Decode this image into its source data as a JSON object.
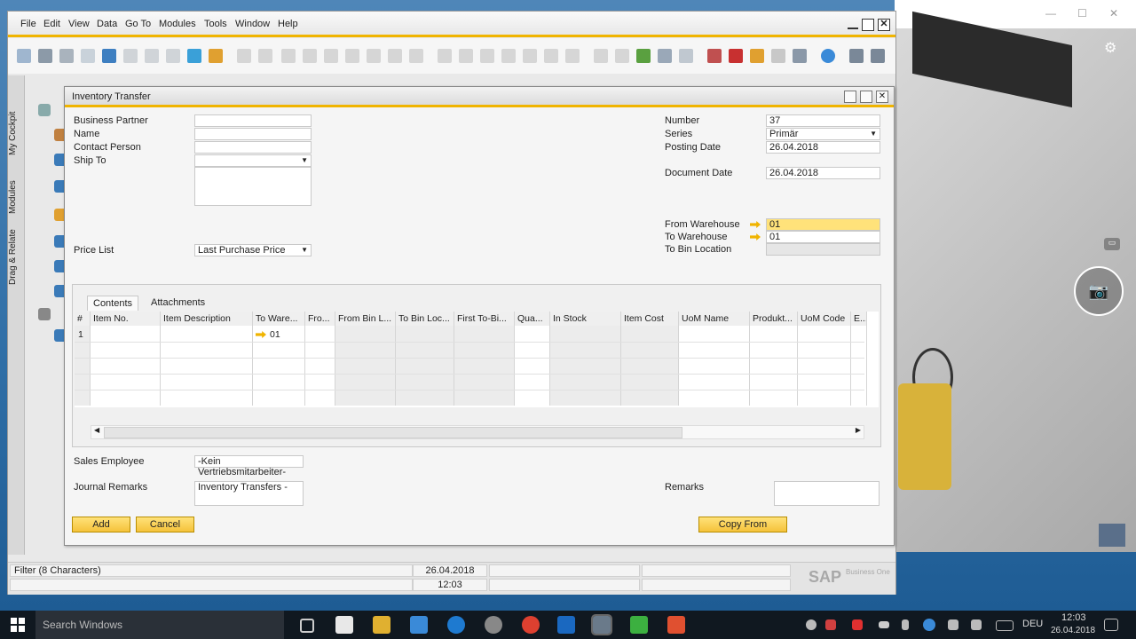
{
  "menubar": {
    "items": [
      "File",
      "Edit",
      "View",
      "Data",
      "Go To",
      "Modules",
      "Tools",
      "Window",
      "Help"
    ]
  },
  "sidebar": {
    "tabs": [
      "My Cockpit",
      "Modules",
      "Drag & Relate"
    ]
  },
  "dialog": {
    "title": "Inventory Transfer",
    "left": {
      "business_partner_label": "Business Partner",
      "name_label": "Name",
      "contact_person_label": "Contact Person",
      "ship_to_label": "Ship To",
      "price_list_label": "Price List",
      "price_list_value": "Last Purchase Price"
    },
    "right": {
      "number_label": "Number",
      "number_value": "37",
      "series_label": "Series",
      "series_value": "Primär",
      "posting_date_label": "Posting Date",
      "posting_date_value": "26.04.2018",
      "document_date_label": "Document Date",
      "document_date_value": "26.04.2018",
      "from_warehouse_label": "From Warehouse",
      "from_warehouse_value": "01",
      "to_warehouse_label": "To Warehouse",
      "to_warehouse_value": "01",
      "to_bin_label": "To Bin Location"
    },
    "tabs": [
      "Contents",
      "Attachments"
    ],
    "grid": {
      "headers": [
        "#",
        "Item No.",
        "Item Description",
        "To Ware...",
        "Fro...",
        "From Bin L...",
        "To Bin Loc...",
        "First To-Bi...",
        "Qua...",
        "In Stock",
        "Item Cost",
        "UoM Name",
        "Produkt...",
        "UoM Code",
        "E..."
      ],
      "row1": {
        "num": "1",
        "to_warehouse": "01"
      }
    },
    "bottom": {
      "sales_employee_label": "Sales Employee",
      "sales_employee_value": "-Kein Vertriebsmitarbeiter-",
      "journal_remarks_label": "Journal Remarks",
      "journal_remarks_value": "Inventory Transfers -",
      "remarks_label": "Remarks"
    },
    "buttons": {
      "add": "Add",
      "cancel": "Cancel",
      "copy_from": "Copy From"
    }
  },
  "statusbar": {
    "filter_text": "Filter (8 Characters)",
    "date": "26.04.2018",
    "time": "12:03",
    "logo_text": "SAP",
    "logo_sub": "Business One"
  },
  "taskbar": {
    "search_placeholder": "Search Windows",
    "lang": "DEU",
    "time": "12:03",
    "date": "26.04.2018"
  },
  "colors": {
    "accent": "#f0b400",
    "field_highlight": "#ffe27a"
  }
}
